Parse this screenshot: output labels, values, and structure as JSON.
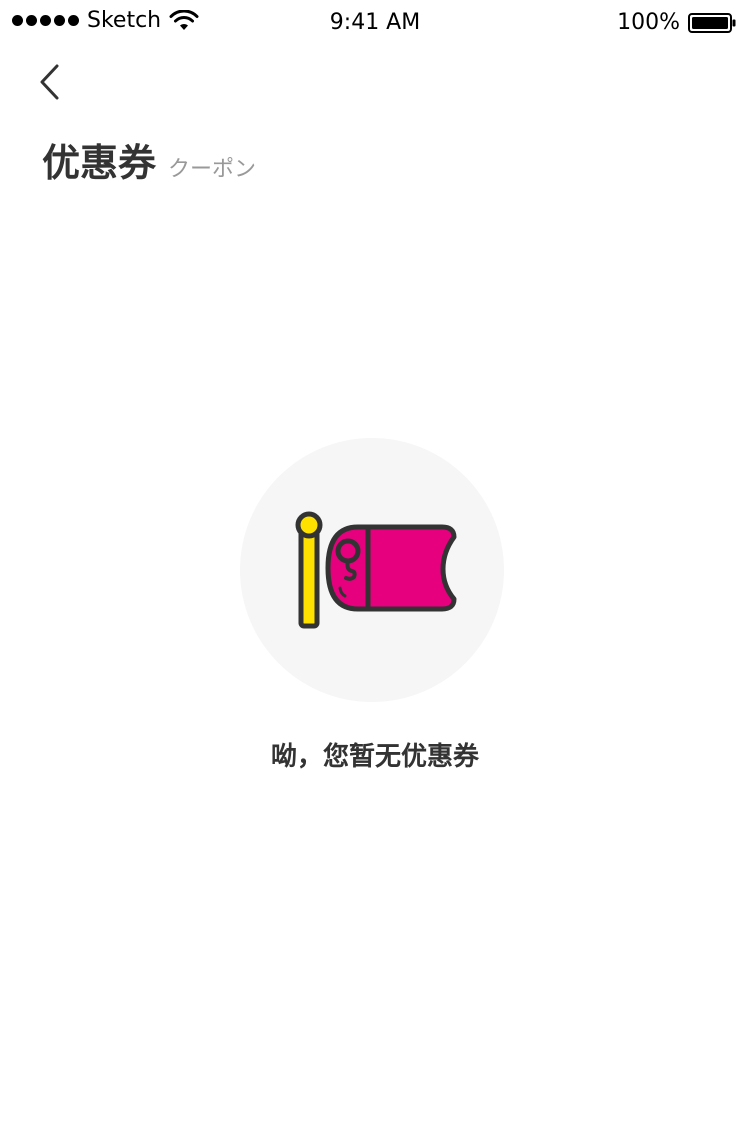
{
  "status_bar": {
    "carrier": "Sketch",
    "time": "9:41 AM",
    "battery": "100%"
  },
  "header": {
    "title": "优惠券",
    "subtitle": "クーポン",
    "back_icon": "chevron-left-icon"
  },
  "empty_state": {
    "message": "呦，您暂无优惠券",
    "illustration_icon": "coupon-flag-icon"
  },
  "colors": {
    "accent_pink": "#E6007E",
    "accent_yellow": "#FFE100",
    "stroke_dark": "#333333",
    "circle_bg": "#F6F6F6",
    "subtitle_gray": "#999999"
  }
}
